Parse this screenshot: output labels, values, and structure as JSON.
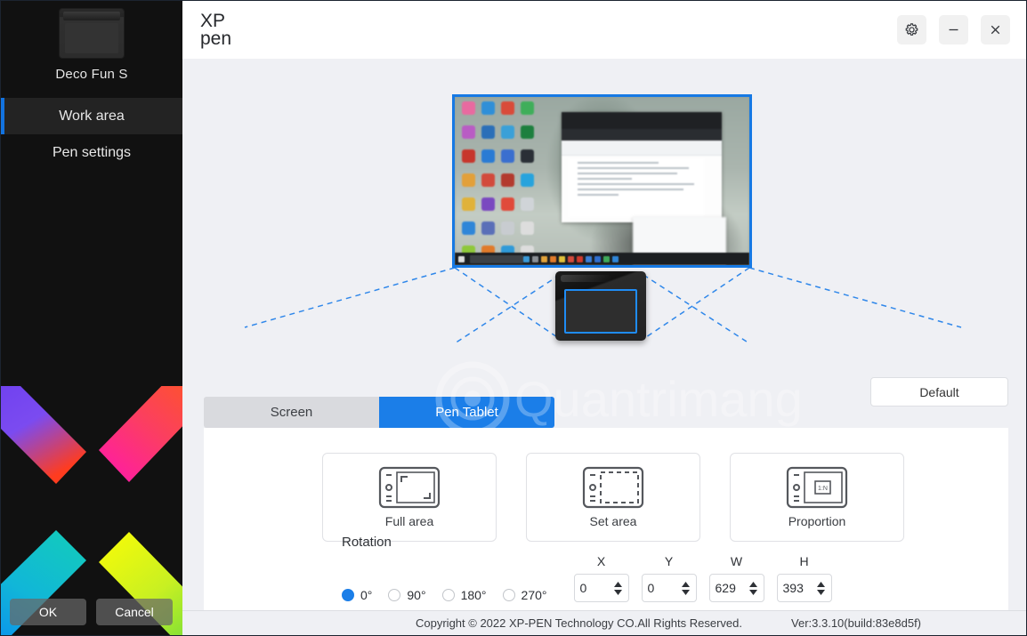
{
  "window": {
    "logo_line1": "XP",
    "logo_line2": "pen",
    "settings_icon": "gear-icon",
    "minimize_icon": "minimize-icon",
    "close_icon": "close-icon"
  },
  "sidebar": {
    "device_name": "Deco Fun S",
    "items": [
      {
        "label": "Work area",
        "active": true
      },
      {
        "label": "Pen settings",
        "active": false
      }
    ],
    "ok_label": "OK",
    "cancel_label": "Cancel"
  },
  "main": {
    "default_button": "Default",
    "tabs": [
      {
        "label": "Screen",
        "active": false
      },
      {
        "label": "Pen Tablet",
        "active": true
      }
    ],
    "cards": [
      {
        "label": "Full area",
        "icon": "tablet-full-area-icon"
      },
      {
        "label": "Set area",
        "icon": "tablet-set-area-icon"
      },
      {
        "label": "Proportion",
        "icon": "tablet-proportion-icon"
      }
    ],
    "rotation": {
      "label": "Rotation",
      "options": [
        "0°",
        "90°",
        "180°",
        "270°"
      ],
      "selected": "0°"
    },
    "coords": [
      {
        "header": "X",
        "value": "0"
      },
      {
        "header": "Y",
        "value": "0"
      },
      {
        "header": "W",
        "value": "629"
      },
      {
        "header": "H",
        "value": "393"
      }
    ]
  },
  "watermark": {
    "text": "Quantrimang"
  },
  "footer": {
    "copyright": "Copyright © 2022  XP-PEN Technology CO.All Rights Reserved.",
    "version": "Ver:3.3.10(build:83e8d5f)"
  },
  "colors": {
    "accent": "#1b7ee8",
    "sidebar_bg": "#111111",
    "content_bg": "#eff0f4",
    "panel_bg": "#ffffff",
    "selection_outline": "#1f8cf5"
  }
}
